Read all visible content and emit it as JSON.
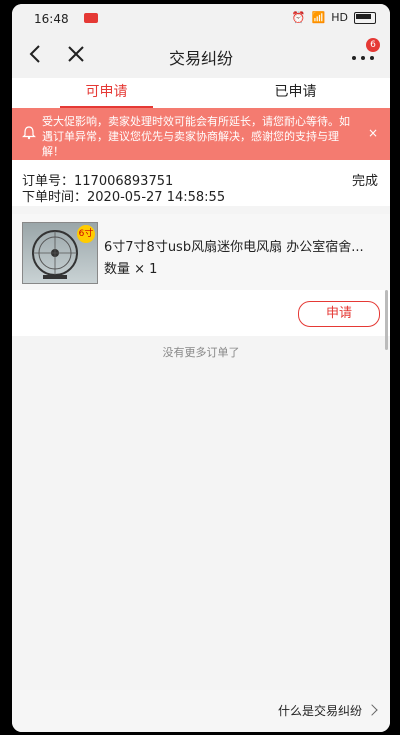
{
  "status_bar": {
    "time": "16:48",
    "network": "HD"
  },
  "header": {
    "title": "交易纠纷",
    "more_badge_count": "6"
  },
  "tabs": [
    {
      "label": "可申请",
      "active": true
    },
    {
      "label": "已申请",
      "active": false
    }
  ],
  "notice": {
    "text": "受大促影响，卖家处理时效可能会有所延长，请您耐心等待。如遇订单异常，建议您优先与卖家协商解决，感谢您的支持与理解！",
    "close_label": "×"
  },
  "order": {
    "order_no_label": "订单号：",
    "order_no": "117006893751",
    "order_time_label": "下单时间：",
    "order_time": "2020-05-27 14:58:55",
    "status": "完成",
    "product": {
      "title": "6寸7寸8寸usb风扇迷你电风扇 办公室宿舍...",
      "quantity": "数量 × 1",
      "image_tag": "6寸"
    },
    "apply_button": "申请"
  },
  "list_end_text": "没有更多订单了",
  "footer": {
    "link_label": "什么是交易纠纷"
  },
  "colors": {
    "accent": "#e53935",
    "notice_bg": "#f47b70"
  }
}
